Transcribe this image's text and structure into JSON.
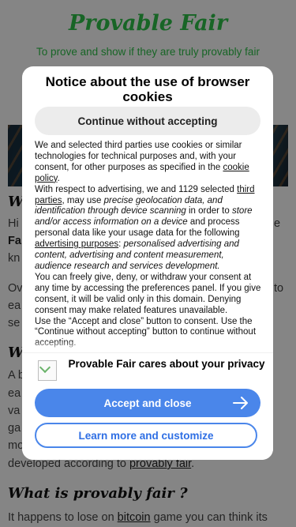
{
  "site": {
    "title": "Provable Fair",
    "subtitle": "To prove and show if they are truly provably fair"
  },
  "page_fragments": {
    "heading1_start": "Wh",
    "para1_start_a": "Hi",
    "para1_start_b": "Fa",
    "para1_start_c": "kn",
    "para1_end": "e",
    "para2_start_a": "Ov",
    "para2_end": "to",
    "para2_start_b": "ea",
    "para2_start_c": "se",
    "heading2_start": "Wh",
    "para3_start_a": "A b",
    "para3_start_b": "ea",
    "para3_start_c": "va",
    "para3_start_d": "ga",
    "para3_start_e": "mo",
    "para3_end_prefix": "developed according to",
    "para3_end_link": "provably fair",
    "para3_end_suffix": ".",
    "heading3": "What is provably fair ?",
    "para4_prefix": "It happens to lose on",
    "para4_link": "bitcoin",
    "para4_suffix": "game you can think its"
  },
  "cookie_notice": {
    "title": "Notice about the use of browser cookies",
    "continue_label": "Continue without accepting",
    "body": {
      "p1_a": "We and selected third parties use cookies or similar technologies for technical purposes and, with your consent, for other purposes as specified in the",
      "p1_link": "cookie policy",
      "p1_end": ".",
      "p2_a": "With respect to advertising, we and 1129 selected",
      "p2_link": "third parties",
      "p2_b": ", may use",
      "p2_i1": "precise geolocation data, and identification through device scanning",
      "p2_c": "in order to",
      "p2_i2": "store and/or access information on a device",
      "p2_d": "and process personal data like your usage data for the following",
      "p2_link2": "advertising purposes",
      "p2_e": ":",
      "p2_i3": "personalised advertising and content, advertising and content measurement, audience research and services development.",
      "p3": "You can freely give, deny, or withdraw your consent at any time by accessing the preferences panel. If you give consent, it will be valid only in this domain. Denying consent may make related features unavailable.",
      "p4": "Use the “Accept and close” button to consent. Use the “Continue without accepting” button to continue without accepting."
    },
    "brand_message": "Provable Fair cares about your privacy",
    "accept_label": "Accept and close",
    "learn_label": "Learn more and customize",
    "colors": {
      "accent": "#4a86ea",
      "scrim": "rgba(0,0,0,0.48)",
      "site_green": "#2ec24a"
    },
    "icons": {
      "accept": "arrow-right-icon",
      "logo": "broken-image-icon"
    }
  }
}
